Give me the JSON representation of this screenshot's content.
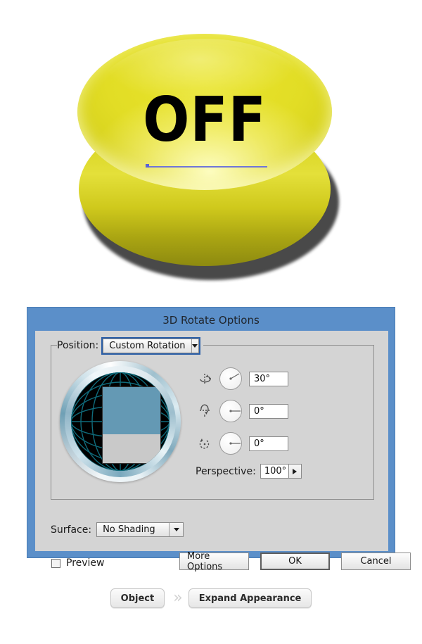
{
  "artwork": {
    "button_label": "OFF",
    "button_color": "#e2dd25",
    "button_side_color": "#bdb814",
    "path_color": "#6f76d8",
    "name": "3d-extruded-off-button"
  },
  "dialog": {
    "title": "3D Rotate Options",
    "titlebar_color": "#5b8fc9",
    "body_color": "#d4d4d4",
    "position": {
      "label": "Position:",
      "value": "Custom Rotation",
      "focused": true
    },
    "trackball": {
      "rect_top_color": "#6499b4",
      "rect_bottom_color": "#c9c9c9",
      "grid_color": "#0f6a7a",
      "sphere_color": "#000000"
    },
    "rotations": [
      {
        "axis": "x",
        "icon": "rotate-x-icon",
        "value": "30°",
        "dial_angle": -60
      },
      {
        "axis": "y",
        "icon": "rotate-y-icon",
        "value": "0°",
        "dial_angle": 0
      },
      {
        "axis": "z",
        "icon": "rotate-z-icon",
        "value": "0°",
        "dial_angle": 0
      }
    ],
    "perspective": {
      "label": "Perspective:",
      "value": "100°"
    },
    "surface": {
      "label": "Surface:",
      "value": "No Shading"
    },
    "preview": {
      "label": "Preview",
      "checked": false
    },
    "buttons": {
      "more_options": "More Options",
      "ok": "OK",
      "cancel": "Cancel"
    }
  },
  "breadcrumb": {
    "first": "Object",
    "separator": "»",
    "second": "Expand Appearance"
  }
}
